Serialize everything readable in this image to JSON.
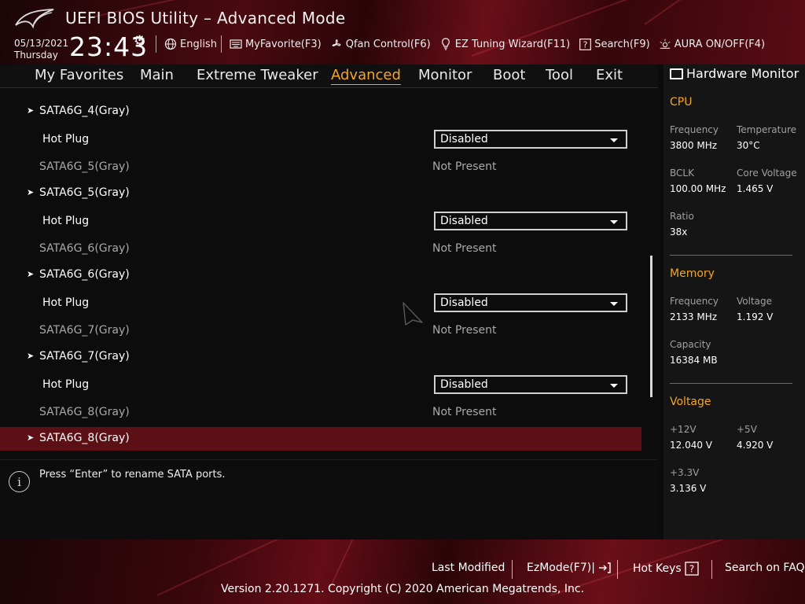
{
  "header": {
    "title": "UEFI BIOS Utility – Advanced Mode",
    "date": "05/13/2021",
    "day": "Thursday",
    "time": "23:43",
    "toolbar": [
      {
        "icon": "globe-icon",
        "label": "English"
      },
      {
        "icon": "keyboard-icon",
        "label": "MyFavorite(F3)"
      },
      {
        "icon": "fan-icon",
        "label": "Qfan Control(F6)"
      },
      {
        "icon": "lightbulb-icon",
        "label": "EZ Tuning Wizard(F11)"
      },
      {
        "icon": "question-icon",
        "label": "Search(F9)"
      },
      {
        "icon": "aura-icon",
        "label": "AURA ON/OFF(F4)"
      }
    ]
  },
  "nav": {
    "tabs": [
      "My Favorites",
      "Main",
      "Extreme Tweaker",
      "Advanced",
      "Monitor",
      "Boot",
      "Tool",
      "Exit"
    ],
    "active": "Advanced"
  },
  "main": {
    "rows": [
      {
        "type": "head",
        "label": "SATA6G_4(Gray)"
      },
      {
        "type": "select",
        "label": "Hot Plug",
        "value": "Disabled"
      },
      {
        "type": "info",
        "label": "SATA6G_5(Gray)",
        "value": "Not Present"
      },
      {
        "type": "head",
        "label": "SATA6G_5(Gray)"
      },
      {
        "type": "select",
        "label": "Hot Plug",
        "value": "Disabled"
      },
      {
        "type": "info",
        "label": "SATA6G_6(Gray)",
        "value": "Not Present"
      },
      {
        "type": "head",
        "label": "SATA6G_6(Gray)"
      },
      {
        "type": "select",
        "label": "Hot Plug",
        "value": "Disabled"
      },
      {
        "type": "info",
        "label": "SATA6G_7(Gray)",
        "value": "Not Present"
      },
      {
        "type": "head",
        "label": "SATA6G_7(Gray)"
      },
      {
        "type": "select",
        "label": "Hot Plug",
        "value": "Disabled"
      },
      {
        "type": "info",
        "label": "SATA6G_8(Gray)",
        "value": "Not Present"
      },
      {
        "type": "head",
        "label": "SATA6G_8(Gray)",
        "selected": true
      }
    ]
  },
  "help": {
    "text": "Press “Enter” to rename SATA ports."
  },
  "hw_monitor": {
    "title": "Hardware Monitor",
    "cpu": {
      "title": "CPU",
      "frequency_label": "Frequency",
      "frequency": "3800 MHz",
      "temperature_label": "Temperature",
      "temperature": "30°C",
      "bclk_label": "BCLK",
      "bclk": "100.00 MHz",
      "core_voltage_label": "Core Voltage",
      "core_voltage": "1.465 V",
      "ratio_label": "Ratio",
      "ratio": "38x"
    },
    "memory": {
      "title": "Memory",
      "frequency_label": "Frequency",
      "frequency": "2133 MHz",
      "voltage_label": "Voltage",
      "voltage": "1.192 V",
      "capacity_label": "Capacity",
      "capacity": "16384 MB"
    },
    "voltage": {
      "title": "Voltage",
      "v12_label": "+12V",
      "v12": "12.040 V",
      "v5_label": "+5V",
      "v5": "4.920 V",
      "v33_label": "+3.3V",
      "v33": "3.136 V"
    }
  },
  "footer": {
    "last_modified": "Last Modified",
    "ezmode": "EzMode(F7)|",
    "hot_keys": "Hot Keys",
    "search_faq": "Search on FAQ",
    "copyright": "Version 2.20.1271. Copyright (C) 2020 American Megatrends, Inc."
  },
  "colors": {
    "accent": "#f5a623",
    "selected_row": "#5d0f16",
    "brand_red": "#6a0f18"
  }
}
